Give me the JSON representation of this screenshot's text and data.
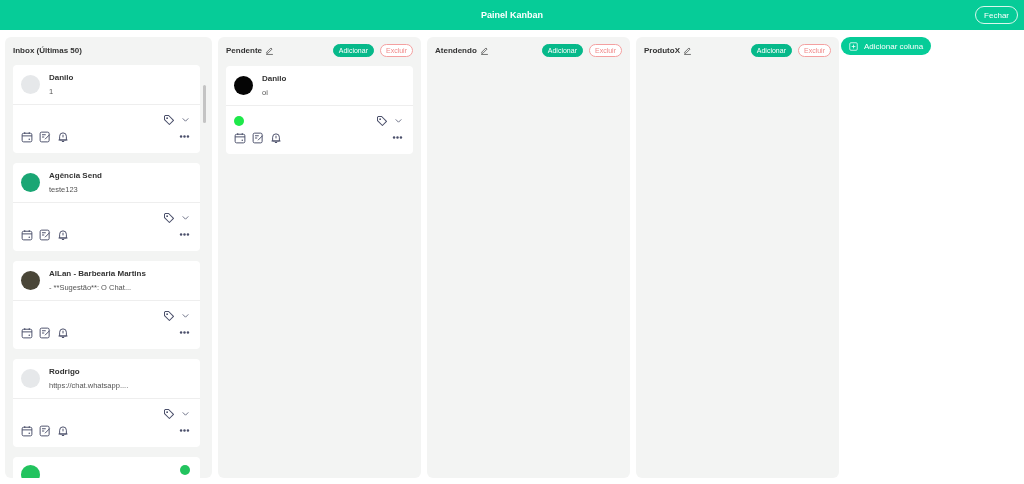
{
  "header": {
    "title": "Painel Kanban",
    "close_button": "Fechar"
  },
  "inbox": {
    "title": "Inbox (Últimas 50)",
    "cards": [
      {
        "name": "Danilo",
        "message": "1",
        "kind": "silhouette"
      },
      {
        "name": "Agência Send",
        "message": "teste123",
        "kind": "green"
      },
      {
        "name": "AlLan - Barbearia Martins",
        "message": "- **Sugestão**: O Chat...",
        "kind": "photo"
      },
      {
        "name": "Rodrigo",
        "message": "https://chat.whatsapp....",
        "kind": "silhouette"
      }
    ]
  },
  "columns": [
    {
      "title": "Pendente",
      "add_button": "Adicionar",
      "delete_button": "Excluir",
      "cards": [
        {
          "name": "Danilo",
          "message": "oi",
          "kind": "dark",
          "color": "#1ee84a"
        }
      ]
    },
    {
      "title": "Atendendo",
      "add_button": "Adicionar",
      "delete_button": "Excluir"
    },
    {
      "title": "ProdutoX",
      "add_button": "Adicionar",
      "delete_button": "Excluir"
    }
  ],
  "add_column_button": "Adicionar coluna"
}
